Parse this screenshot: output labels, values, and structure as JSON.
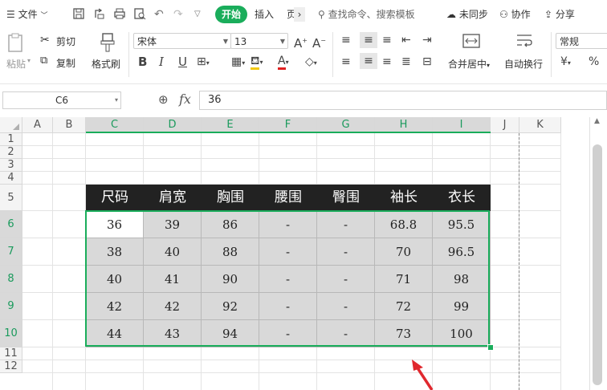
{
  "topbar": {
    "file_label": "文件",
    "start_tab": "开始",
    "insert_tab": "插入",
    "page_tab": "页",
    "search_placeholder": "查找命令、搜索模板",
    "sync_label": "未同步",
    "collab_label": "协作",
    "share_label": "分享"
  },
  "ribbon": {
    "paste_label": "粘贴",
    "cut_label": "剪切",
    "copy_label": "复制",
    "format_painter_label": "格式刷",
    "font_name": "宋体",
    "font_size": "13",
    "merge_label": "合并居中",
    "wrap_label": "自动换行",
    "number_format": "常规",
    "currency_symbol": "¥",
    "percent_symbol": "%",
    "bold": "B",
    "italic": "I",
    "underline": "U"
  },
  "formula_bar": {
    "name_box": "C6",
    "fx": "fx",
    "value": "36"
  },
  "grid": {
    "columns": [
      "A",
      "B",
      "C",
      "D",
      "E",
      "F",
      "G",
      "H",
      "I",
      "J",
      "K"
    ],
    "rows": [
      "1",
      "2",
      "3",
      "4",
      "5",
      "6",
      "7",
      "8",
      "9",
      "10",
      "11",
      "12"
    ],
    "table_header": [
      "尺码",
      "肩宽",
      "胸围",
      "腰围",
      "臀围",
      "袖长",
      "衣长"
    ],
    "table_rows": [
      [
        "36",
        "39",
        "86",
        "-",
        "-",
        "68.8",
        "95.5"
      ],
      [
        "38",
        "40",
        "88",
        "-",
        "-",
        "70",
        "96.5"
      ],
      [
        "40",
        "41",
        "90",
        "-",
        "-",
        "71",
        "98"
      ],
      [
        "42",
        "42",
        "92",
        "-",
        "-",
        "72",
        "99"
      ],
      [
        "44",
        "43",
        "94",
        "-",
        "-",
        "73",
        "100"
      ]
    ]
  },
  "colors": {
    "accent_green": "#1aad5b",
    "table_header_bg": "#222222",
    "table_body_bg": "#d9d9d9",
    "arrow_red": "#e0282e"
  }
}
